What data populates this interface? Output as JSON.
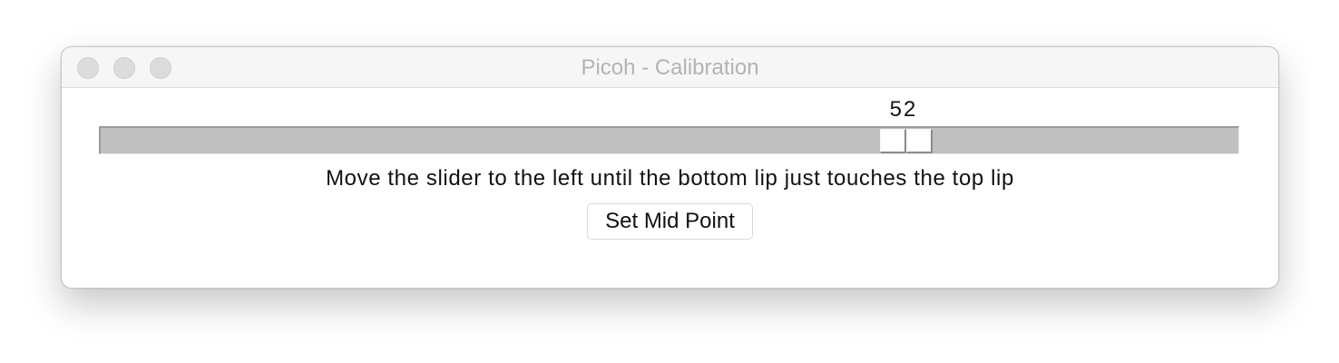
{
  "window": {
    "title": "Picoh - Calibration",
    "traffic_lights": [
      "close",
      "minimize",
      "zoom"
    ]
  },
  "slider": {
    "value": "52",
    "value_numeric": 52,
    "min": 0,
    "max": 100
  },
  "instruction": "Move the slider to the left until the bottom lip just touches the top lip",
  "buttons": {
    "set_mid_point": "Set Mid Point"
  },
  "colors": {
    "track": "#c0c0c0",
    "thumb": "#ffffff",
    "title_text": "#b3b3b3",
    "text": "#111111"
  }
}
